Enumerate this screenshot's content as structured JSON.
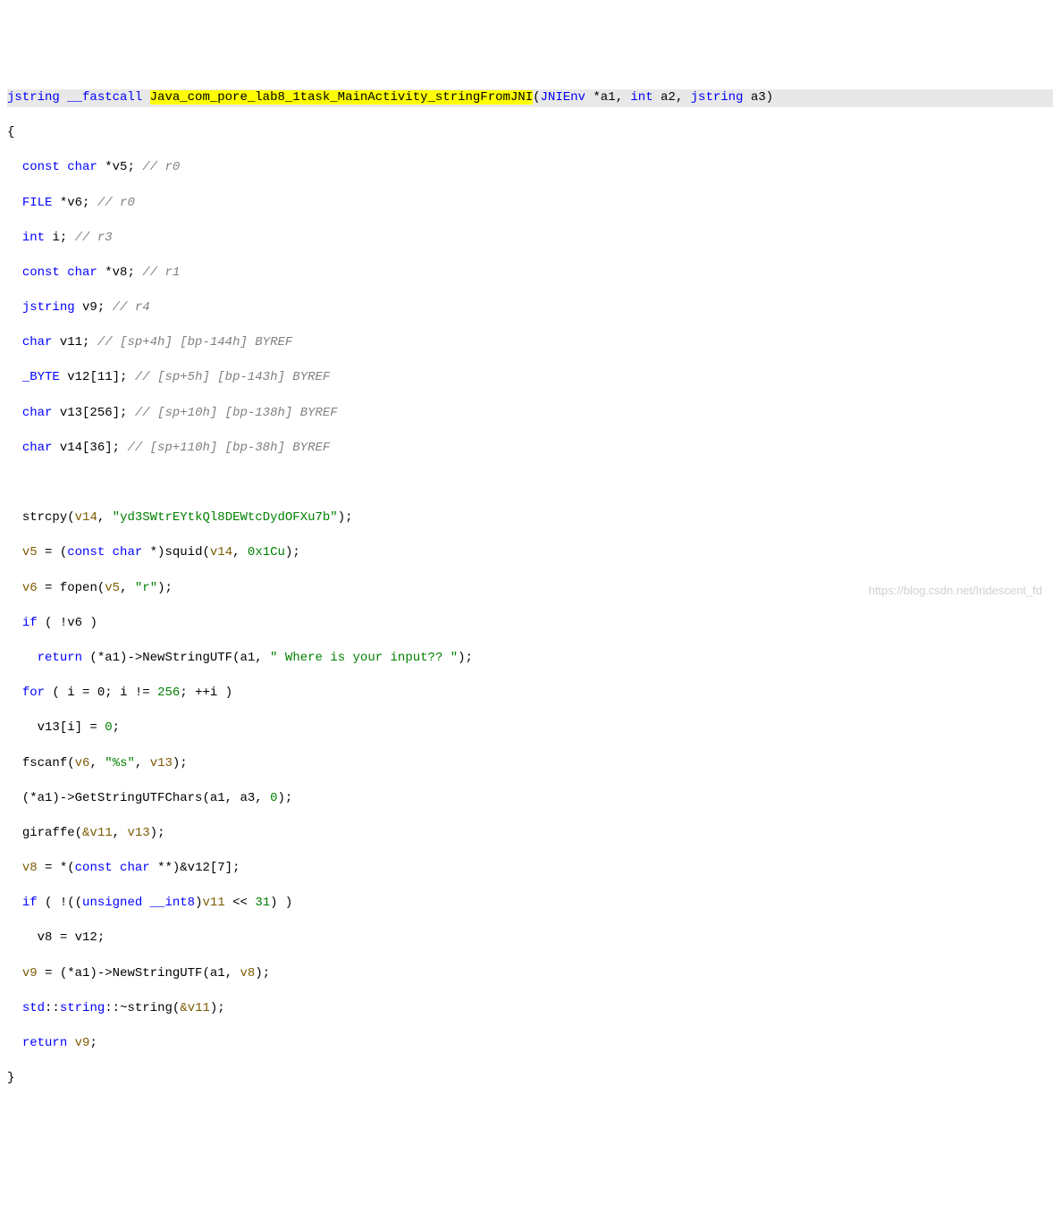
{
  "signature": {
    "ret_type": "jstring",
    "call_conv": "__fastcall",
    "fn_name": "Java_com_pore_lab8_1task_MainActivity_stringFromJNI",
    "p1_type": "JNIEnv",
    "p1_name": "*a1",
    "p2_type": "int",
    "p2_name": "a2",
    "p3_type": "jstring",
    "p3_name": "a3"
  },
  "decls": {
    "d1_type": "const char",
    "d1_name": "*v5;",
    "d1_comment": "// r0",
    "d2_type": "FILE",
    "d2_name": "*v6;",
    "d2_comment": "// r0",
    "d3_type": "int",
    "d3_name": "i;",
    "d3_comment": "// r3",
    "d4_type": "const char",
    "d4_name": "*v8;",
    "d4_comment": "// r1",
    "d5_type": "jstring",
    "d5_name": "v9;",
    "d5_comment": "// r4",
    "d6_type": "char",
    "d6_name": "v11;",
    "d6_comment": "// [sp+4h] [bp-144h] BYREF",
    "d7_type": "_BYTE",
    "d7_name": "v12[11];",
    "d7_comment": "// [sp+5h] [bp-143h] BYREF",
    "d8_type": "char",
    "d8_name": "v13[256];",
    "d8_comment": "// [sp+10h] [bp-138h] BYREF",
    "d9_type": "char",
    "d9_name": "v14[36];",
    "d9_comment": "// [sp+110h] [bp-38h] BYREF"
  },
  "body": {
    "strcpy_fn": "strcpy",
    "strcpy_arg1": "v14",
    "strcpy_str": "\"yd3SWtrEYtkQl8DEWtcDydOFXu7b\"",
    "v5_assign_lhs": "v5",
    "v5_cast": "const char",
    "squid_fn": "squid",
    "squid_arg1": "v14",
    "squid_arg2": "0x1Cu",
    "v6_assign_lhs": "v6",
    "fopen_fn": "fopen",
    "fopen_arg1": "v5",
    "fopen_mode": "\"r\"",
    "if_cond": "!v6",
    "ret1_kw": "return",
    "nsu_call1": "NewStringUTF",
    "nsu_arg1a": "a1",
    "nsu_str1": "\" Where is your input?? \"",
    "for_init": "i = 0",
    "for_cond_l": "i",
    "for_cond_r": "256",
    "for_inc": "++i",
    "for_body_lhs": "v13[i]",
    "for_body_rhs": "0",
    "fscanf_fn": "fscanf",
    "fscanf_arg1": "v6",
    "fscanf_fmt": "\"%s\"",
    "fscanf_arg3": "v13",
    "gsc_call": "GetStringUTFChars",
    "gsc_arg1": "a1",
    "gsc_arg2": "a3",
    "gsc_arg3": "0",
    "giraffe_fn": "giraffe",
    "giraffe_arg1": "&v11",
    "giraffe_arg2": "v13",
    "v8_assign_lhs": "v8",
    "v8_cast": "const char",
    "v8_rhs": "**)&v12[7]",
    "if2_cast": "unsigned __int8",
    "if2_var": "v11",
    "if2_shift": "31",
    "v8_reassign": "v8 = v12;",
    "v9_assign_lhs": "v9",
    "nsu_call2": "NewStringUTF",
    "nsu_arg2a": "a1",
    "nsu_arg2b": "v8",
    "std_ns": "std",
    "string_cls": "string",
    "dtor": "~string",
    "dtor_arg": "&v11",
    "ret2": "return",
    "ret2_val": "v9"
  },
  "kw": {
    "if": "if",
    "for": "for",
    "return": "return"
  },
  "watermark": "https://blog.csdn.net/Iridescent_fd"
}
